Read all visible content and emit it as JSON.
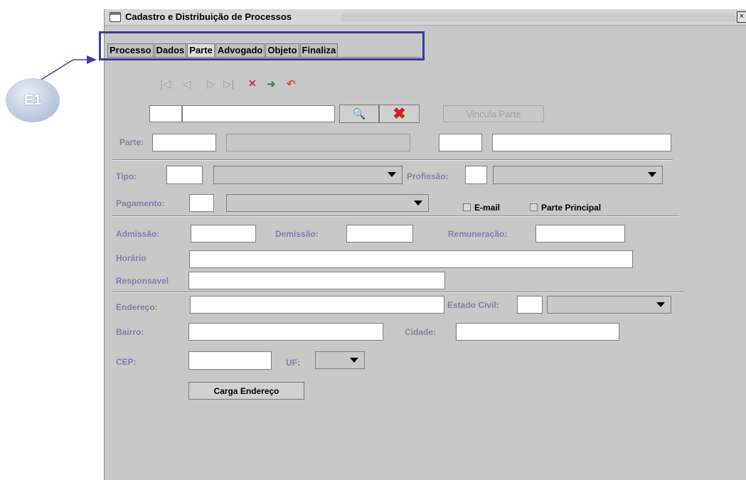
{
  "annotation": {
    "label": "E1"
  },
  "window": {
    "title": "Cadastro e Distribuição de Processos",
    "close_glyph": "×"
  },
  "tabs": [
    {
      "label": "Processo",
      "active": false
    },
    {
      "label": "Dados",
      "active": false
    },
    {
      "label": "Parte",
      "active": true
    },
    {
      "label": "Advogado",
      "active": false
    },
    {
      "label": "Objeto",
      "active": false
    },
    {
      "label": "Finaliza",
      "active": false
    }
  ],
  "toolbar": {
    "first_glyph": "|◁",
    "prev_glyph": "◁",
    "next_glyph": "▷",
    "last_glyph": "▷|",
    "delete_glyph": "✕",
    "save_glyph": "➜",
    "undo_glyph": "↶"
  },
  "search": {
    "code_value": "",
    "name_value": "",
    "search_glyph": "🔍",
    "clear_glyph": "✖",
    "link_button": "Vincula Parte"
  },
  "form": {
    "parte_label": "Parte:",
    "tipo_label": "Tipo:",
    "profissao_label": "Profissão:",
    "pagamento_label": "Pagamento:",
    "email_label": "E-mail",
    "parte_principal_label": "Parte Principal",
    "admissao_label": "Admissão:",
    "demissao_label": "Demissão:",
    "remuneracao_label": "Remuneração:",
    "horario_label": "Horário",
    "responsavel_label": "Responsavel",
    "endereco_label": "Endereço:",
    "estado_civil_label": "Estado Civil:",
    "bairro_label": "Bairro:",
    "cidade_label": "Cidade:",
    "cep_label": "CEP:",
    "uf_label": "UF:",
    "carga_button": "Carga Endereço"
  },
  "colors": {
    "annotation_box": "#3c3c9c",
    "label_color": "#7d7fa8",
    "clear_icon": "#d0241b",
    "window_bg": "#c8c8c8"
  }
}
